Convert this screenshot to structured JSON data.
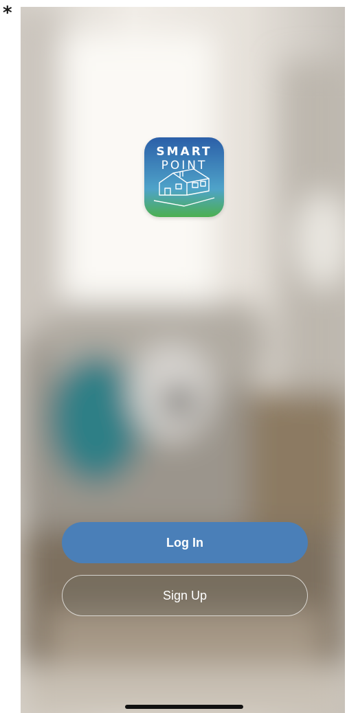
{
  "marker": {
    "glyph": "*"
  },
  "logo": {
    "word_top": "SMART",
    "word_bottom": "POINT",
    "name": "smart-point-house-logo",
    "colors": {
      "top": "#2b5fa8",
      "bottom": "#4caf50"
    }
  },
  "actions": {
    "login_label": "Log In",
    "signup_label": "Sign Up"
  },
  "colors": {
    "primary": "#4a7fb8"
  }
}
